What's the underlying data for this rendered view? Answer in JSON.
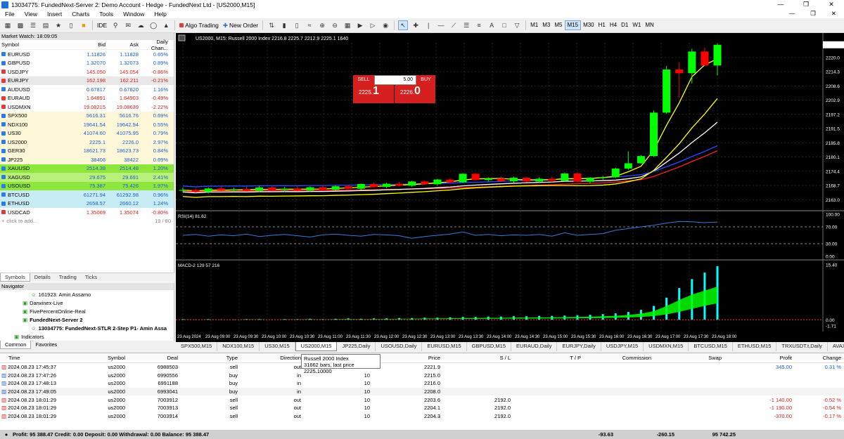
{
  "window": {
    "title": "13034775: FundedNext-Server 2: Demo Account - Hedge - FundedNext Ltd - [US2000,M15]"
  },
  "menu": [
    "File",
    "View",
    "Insert",
    "Charts",
    "Tools",
    "Window",
    "Help"
  ],
  "toolbar": {
    "ide_label": "IDE",
    "algo_label": "Algo Trading",
    "new_order_label": "New Order",
    "timeframes": [
      "M1",
      "M3",
      "M5",
      "M15",
      "M30",
      "H1",
      "H4",
      "D1",
      "W1",
      "MN"
    ],
    "active_tf": "M15"
  },
  "market_watch": {
    "title": "Market Watch: 18:09:05",
    "headers": {
      "symbol": "Symbol",
      "bid": "Bid",
      "ask": "Ask",
      "change": "Daily Chan..."
    },
    "rows": [
      {
        "symbol": "EURUSD",
        "bid": "1.11826",
        "ask": "1.11828",
        "change": "0.65%",
        "dir": "up",
        "bg": "#ffffff"
      },
      {
        "symbol": "GBPUSD",
        "bid": "1.32070",
        "ask": "1.32073",
        "change": "0.89%",
        "dir": "up",
        "bg": "#ffffff"
      },
      {
        "symbol": "USDJPY",
        "bid": "145.050",
        "ask": "145.054",
        "change": "-0.86%",
        "dir": "down",
        "bg": "#ffffff"
      },
      {
        "symbol": "EURJPY",
        "bid": "162.198",
        "ask": "162.211",
        "change": "-0.21%",
        "dir": "down",
        "bg": "#e8e8e8"
      },
      {
        "symbol": "AUDUSD",
        "bid": "0.67817",
        "ask": "0.67820",
        "change": "1.16%",
        "dir": "up",
        "bg": "#ffffff"
      },
      {
        "symbol": "EURAUD",
        "bid": "1.64891",
        "ask": "1.64903",
        "change": "-0.49%",
        "dir": "down",
        "bg": "#ffffff"
      },
      {
        "symbol": "USDMXN",
        "bid": "19.08215",
        "ask": "19.08639",
        "change": "-2.22%",
        "dir": "down",
        "bg": "#ffffff"
      },
      {
        "symbol": "SPX500",
        "bid": "5616.31",
        "ask": "5616.76",
        "change": "0.69%",
        "dir": "up",
        "bg": "#fff8d8"
      },
      {
        "symbol": "NDX100",
        "bid": "19641.54",
        "ask": "19642.94",
        "change": "0.55%",
        "dir": "up",
        "bg": "#fff8d8"
      },
      {
        "symbol": "US30",
        "bid": "41074.60",
        "ask": "41075.95",
        "change": "0.79%",
        "dir": "up",
        "bg": "#fff8d8"
      },
      {
        "symbol": "US2000",
        "bid": "2225.1",
        "ask": "2226.0",
        "change": "2.97%",
        "dir": "up",
        "bg": "#fff8d8"
      },
      {
        "symbol": "GER30",
        "bid": "18621.73",
        "ask": "18623.73",
        "change": "0.84%",
        "dir": "up",
        "bg": "#fff8d8"
      },
      {
        "symbol": "JP225",
        "bid": "38406",
        "ask": "38422",
        "change": "0.69%",
        "dir": "up",
        "bg": "#fff8d8"
      },
      {
        "symbol": "XAUUSD",
        "bid": "2514.38",
        "ask": "2514.48",
        "change": "1.20%",
        "dir": "up",
        "bg": "#8ee63c"
      },
      {
        "symbol": "XAGUSD",
        "bid": "29.675",
        "ask": "29.691",
        "change": "2.41%",
        "dir": "up",
        "bg": "#b9f07a"
      },
      {
        "symbol": "USOUSD",
        "bid": "75.387",
        "ask": "75.426",
        "change": "1.97%",
        "dir": "up",
        "bg": "#8ee63c"
      },
      {
        "symbol": "BTCUSD",
        "bid": "61271.94",
        "ask": "61292.98",
        "change": "0.96%",
        "dir": "up",
        "bg": "#c8ecf4"
      },
      {
        "symbol": "ETHUSD",
        "bid": "2658.57",
        "ask": "2660.12",
        "change": "1.24%",
        "dir": "up",
        "bg": "#c8ecf4"
      },
      {
        "symbol": "USDCAD",
        "bid": "1.35069",
        "ask": "1.35074",
        "change": "-0.80%",
        "dir": "down",
        "bg": "#ffffff"
      }
    ],
    "add_label": "click to add...",
    "count": "19 / 80",
    "tabs": [
      "Symbols",
      "Details",
      "Trading",
      "Ticks"
    ]
  },
  "navigator": {
    "title": "Navigator",
    "items": [
      {
        "label": "161923: Amin Assamo",
        "level": 2
      },
      {
        "label": "Darwinex-Live",
        "level": 1
      },
      {
        "label": "FivePercentOnline-Real",
        "level": 1
      },
      {
        "label": "FundedNext-Server 2",
        "level": 1
      },
      {
        "label": "13034775: FundedNext-STLR 2-Step P1- Amin Assa",
        "level": 2
      },
      {
        "label": "Indicators",
        "level": 0
      }
    ],
    "tabs": [
      "Common",
      "Favorites"
    ]
  },
  "chart": {
    "header": "US2000, M15:  Russell 2000 Index  2216.8 2225.7 2212.9 2225.1  1640",
    "sell_label": "SELL",
    "buy_label": "BUY",
    "lot": "5.00",
    "sell_big": "2225.",
    "sell_small": "1",
    "buy_big": "2226.",
    "buy_small": "0",
    "rsi_label": "RSI(14) 81.62",
    "macd_label": "MACD-2 129 57 216",
    "price_axis": [
      "2220.0",
      "2214.3",
      "2208.6",
      "2202.9",
      "2197.2",
      "2191.5",
      "2185.8",
      "2180.1",
      "2174.4",
      "2168.7",
      "2163.0"
    ],
    "rsi_axis": [
      "100.00",
      "70.00",
      "30.00",
      "0.00"
    ],
    "macd_axis": [
      "15.40",
      "0.00",
      "-1.71"
    ],
    "time_axis": [
      "23 Aug 2024",
      "23 Aug 09:00",
      "23 Aug 09:30",
      "23 Aug 10:00",
      "23 Aug 10:30",
      "23 Aug 11:00",
      "23 Aug 11:30",
      "23 Aug 12:00",
      "23 Aug 12:30",
      "23 Aug 13:00",
      "23 Aug 13:30",
      "23 Aug 14:00",
      "23 Aug 14:30",
      "23 Aug 15:00",
      "23 Aug 15:30",
      "23 Aug 16:00",
      "23 Aug 16:30",
      "23 Aug 17:00",
      "23 Aug 17:30",
      "23 Aug 18:00"
    ],
    "candles": [
      [
        2166.6,
        2167.9,
        2165.7,
        2166.9
      ],
      [
        2166.9,
        2167.6,
        2165.8,
        2166.2
      ],
      [
        2166.2,
        2168.0,
        2165.5,
        2167.5
      ],
      [
        2167.5,
        2168.4,
        2166.3,
        2166.8
      ],
      [
        2166.8,
        2167.9,
        2166.0,
        2167.2
      ],
      [
        2167.2,
        2168.1,
        2166.3,
        2166.6
      ],
      [
        2166.6,
        2168.5,
        2166.0,
        2167.9
      ],
      [
        2167.9,
        2168.3,
        2166.5,
        2166.9
      ],
      [
        2166.9,
        2168.2,
        2166.1,
        2167.4
      ],
      [
        2167.4,
        2168.6,
        2166.4,
        2166.7
      ],
      [
        2166.7,
        2168.4,
        2166.1,
        2168.0
      ],
      [
        2168.0,
        2168.6,
        2166.6,
        2167.0
      ],
      [
        2167.0,
        2168.7,
        2166.6,
        2168.4
      ],
      [
        2168.4,
        2168.9,
        2167.1,
        2167.4
      ],
      [
        2167.4,
        2169.5,
        2166.9,
        2169.3
      ],
      [
        2169.3,
        2169.8,
        2167.8,
        2168.1
      ],
      [
        2168.1,
        2169.8,
        2167.7,
        2169.4
      ],
      [
        2169.4,
        2170.2,
        2168.3,
        2168.6
      ],
      [
        2168.6,
        2170.6,
        2168.1,
        2170.3
      ],
      [
        2170.3,
        2170.8,
        2169.0,
        2169.2
      ],
      [
        2169.2,
        2171.4,
        2168.6,
        2171.1
      ],
      [
        2171.1,
        2171.6,
        2169.7,
        2170.0
      ],
      [
        2170.0,
        2173.6,
        2169.7,
        2173.4
      ],
      [
        2173.4,
        2173.8,
        2170.6,
        2170.9
      ],
      [
        2170.9,
        2172.0,
        2170.2,
        2171.5
      ],
      [
        2171.5,
        2172.3,
        2170.1,
        2170.4
      ],
      [
        2170.4,
        2172.2,
        2169.8,
        2171.8
      ],
      [
        2171.8,
        2172.1,
        2170.0,
        2170.3
      ],
      [
        2170.3,
        2172.0,
        2169.8,
        2171.4
      ],
      [
        2171.4,
        2172.2,
        2170.1,
        2170.6
      ],
      [
        2170.6,
        2173.9,
        2170.2,
        2173.5
      ],
      [
        2173.5,
        2174.0,
        2170.0,
        2170.2
      ],
      [
        2170.2,
        2172.1,
        2169.5,
        2171.8
      ],
      [
        2171.8,
        2172.6,
        2171.0,
        2172.0
      ],
      [
        2172.0,
        2175.8,
        2171.7,
        2175.5
      ],
      [
        2175.5,
        2182.4,
        2175.0,
        2177.6
      ],
      [
        2177.6,
        2180.9,
        2177.4,
        2180.5
      ],
      [
        2180.5,
        2198.8,
        2180.1,
        2197.9
      ],
      [
        2197.9,
        2216.6,
        2197.4,
        2215.2
      ],
      [
        2215.2,
        2218.1,
        2203.9,
        2213.7
      ],
      [
        2213.7,
        2223.5,
        2209.6,
        2222.4
      ],
      [
        2222.4,
        2224.0,
        2216.8,
        2216.8
      ],
      [
        2216.8,
        2225.7,
        2212.9,
        2225.1
      ]
    ],
    "rsi": [
      50,
      52,
      48,
      51,
      49,
      53,
      47,
      50,
      52,
      49,
      46,
      51,
      53,
      50,
      48,
      52,
      51,
      49,
      43,
      47,
      50,
      53,
      58,
      50,
      52,
      49,
      51,
      50,
      52,
      48,
      56,
      50,
      52,
      54,
      62,
      66,
      70,
      74,
      79,
      83,
      82,
      80,
      81.62
    ],
    "macd": [
      0.2,
      0.1,
      0.2,
      0.1,
      0.1,
      0.2,
      0.2,
      0.1,
      0.2,
      0.2,
      0.3,
      0.2,
      0.3,
      0.4,
      0.3,
      0.4,
      0.4,
      0.5,
      0.5,
      0.6,
      0.6,
      0.7,
      0.8,
      0.8,
      0.9,
      0.9,
      1.0,
      1.0,
      1.1,
      1.1,
      1.2,
      1.3,
      1.4,
      1.6,
      1.8,
      2.2,
      2.8,
      3.9,
      6.2,
      8.9,
      11.4,
      13.2,
      15.0
    ],
    "colors": {
      "bull": "#00ff00",
      "bear": "#ff0000",
      "ma_fast": "#ffff00",
      "ma_mid": "#ffffff",
      "ma_slow": "#ff2020",
      "ma_blue": "#2a4bff",
      "rsi": "#3a7bd5",
      "macd": "#00ffff"
    }
  },
  "chart_tabs": [
    "SPX500,M15",
    "NDX100,M15",
    "US30,M15",
    "US2000,M15",
    "JP225,Daily",
    "USOUSD,Daily",
    "EURUSD,M15",
    "GBPUSD,M15",
    "EURAUD,Daily",
    "EURJPY,Daily",
    "USDJPY,M15",
    "USDMXN,M15",
    "BTCUSD,M15",
    "ETHUSD,M15",
    "TRXUSDT.t,Daily",
    "AVAXUSDT.t,Daily"
  ],
  "tooltip": {
    "line1": "Russell 2000 Index",
    "line2": "31662 bars, last price 2225.10000"
  },
  "terminal": {
    "headers": [
      "Time",
      "Symbol",
      "Deal",
      "Type",
      "Direction",
      "Volume",
      "Price",
      "S / L",
      "T / P",
      "Commission",
      "Swap",
      "Profit",
      "Change"
    ],
    "rows": [
      {
        "time": "2024.08.23 17:45:37",
        "symbol": "us2000",
        "deal": "6988503",
        "type": "sell",
        "direction": "out",
        "volume": "10",
        "price": "2221.9",
        "sl": "",
        "tp": "",
        "commission": "",
        "swap": "",
        "profit": "345.00",
        "change": "0.31 %",
        "neg": false
      },
      {
        "time": "2024.08.23 17:47:26",
        "symbol": "us2000",
        "deal": "6990556",
        "type": "buy",
        "direction": "in",
        "volume": "10",
        "price": "2215.0",
        "sl": "",
        "tp": "",
        "commission": "",
        "swap": "",
        "profit": "",
        "change": "",
        "neg": false
      },
      {
        "time": "2024.08.23 17:48:13",
        "symbol": "us2000",
        "deal": "6991188",
        "type": "buy",
        "direction": "in",
        "volume": "10",
        "price": "2216.0",
        "sl": "",
        "tp": "",
        "commission": "",
        "swap": "",
        "profit": "",
        "change": "",
        "neg": false
      },
      {
        "time": "2024.08.23 17:49:05",
        "symbol": "us2000",
        "deal": "6993041",
        "type": "buy",
        "direction": "in",
        "volume": "10",
        "price": "2208.0",
        "sl": "",
        "tp": "",
        "commission": "",
        "swap": "",
        "profit": "",
        "change": "",
        "neg": false
      },
      {
        "time": "2024.08.23 18:01:29",
        "symbol": "us2000",
        "deal": "7003912",
        "type": "sell",
        "direction": "out",
        "volume": "10",
        "price": "2203.6",
        "sl": "2192.0",
        "tp": "",
        "commission": "",
        "swap": "",
        "profit": "-1 140.00",
        "change": "-0.52 %",
        "neg": true
      },
      {
        "time": "2024.08.23 18:01:29",
        "symbol": "us2000",
        "deal": "7003913",
        "type": "sell",
        "direction": "out",
        "volume": "10",
        "price": "2204.1",
        "sl": "2192.0",
        "tp": "",
        "commission": "",
        "swap": "",
        "profit": "-1 190.00",
        "change": "-0.54 %",
        "neg": true
      },
      {
        "time": "2024.08.23 18:01:29",
        "symbol": "us2000",
        "deal": "7003914",
        "type": "sell",
        "direction": "out",
        "volume": "10",
        "price": "2204.3",
        "sl": "2192.0",
        "tp": "",
        "commission": "",
        "swap": "",
        "profit": "-370.00",
        "change": "-0.17 %",
        "neg": true
      }
    ],
    "footer": {
      "summary": "Profit: 95 388.47  Credit: 0.00  Deposit: 0.00  Withdrawal: 0.00  Balance: 95 388.47",
      "commission": "-93.63",
      "swap": "-260.15",
      "profit": "95 742.25"
    }
  }
}
